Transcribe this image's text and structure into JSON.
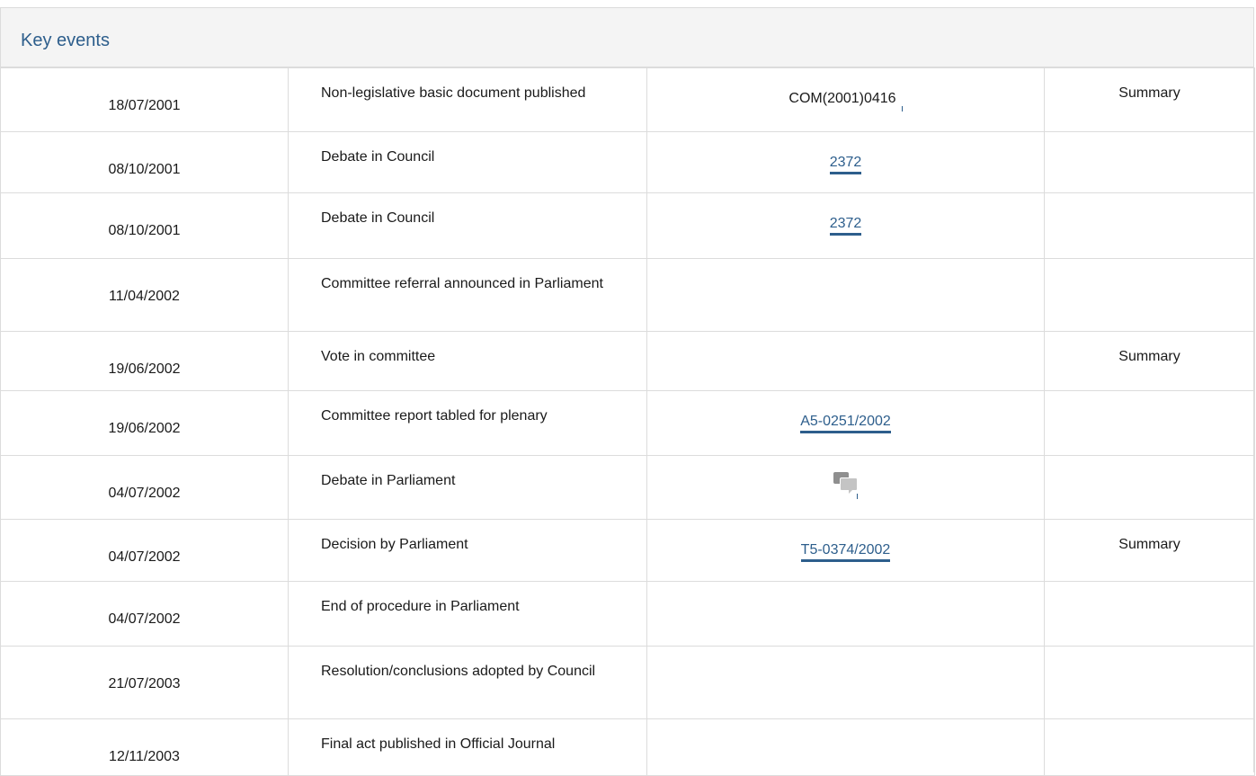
{
  "title": "Key events",
  "rows": [
    {
      "date": "18/07/2001",
      "event": "Non-legislative basic document published",
      "doc": "COM(2001)0416",
      "doc_type": "text",
      "summary": "Summary"
    },
    {
      "date": "08/10/2001",
      "event": "Debate in Council",
      "doc": "2372",
      "doc_type": "link",
      "summary": ""
    },
    {
      "date": "08/10/2001",
      "event": "Debate in Council",
      "doc": "2372",
      "doc_type": "link",
      "summary": ""
    },
    {
      "date": "11/04/2002",
      "event": "Committee referral announced in Parliament",
      "doc": "",
      "doc_type": "none",
      "summary": ""
    },
    {
      "date": "19/06/2002",
      "event": "Vote in committee",
      "doc": "",
      "doc_type": "none",
      "summary": "Summary"
    },
    {
      "date": "19/06/2002",
      "event": "Committee report tabled for plenary",
      "doc": "A5-0251/2002",
      "doc_type": "link",
      "summary": ""
    },
    {
      "date": "04/07/2002",
      "event": "Debate in Parliament",
      "doc": "",
      "doc_type": "icon",
      "icon": "debate-speech-bubbles-icon",
      "summary": ""
    },
    {
      "date": "04/07/2002",
      "event": "Decision by Parliament",
      "doc": "T5-0374/2002",
      "doc_type": "link",
      "summary": "Summary"
    },
    {
      "date": "04/07/2002",
      "event": "End of procedure in Parliament",
      "doc": "",
      "doc_type": "none",
      "summary": ""
    },
    {
      "date": "21/07/2003",
      "event": "Resolution/conclusions adopted by Council",
      "doc": "",
      "doc_type": "none",
      "summary": ""
    },
    {
      "date": "12/11/2003",
      "event": "Final act published in Official Journal",
      "doc": "",
      "doc_type": "none",
      "summary": ""
    }
  ],
  "colors": {
    "link": "#2d5e8c",
    "border": "#dcdcdc",
    "header_bg": "#f4f4f4"
  }
}
